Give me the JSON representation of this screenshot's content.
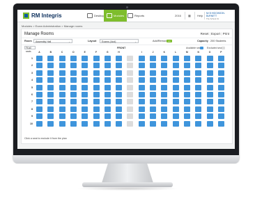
{
  "app": {
    "name": "RM Integris"
  },
  "nav": [
    {
      "label": "Desktop",
      "icon": "desktop-icon",
      "active": false
    },
    {
      "label": "Modules",
      "icon": "modules-icon",
      "active": true
    },
    {
      "label": "Reports",
      "icon": "reports-icon",
      "active": false
    }
  ],
  "top_right": {
    "item1": "2016",
    "help": "Help",
    "user": "Mr B HIGGINSON-BURNETT",
    "user_sub": "The School 01"
  },
  "breadcrumb": "Modules > Exam Administration > Manage rooms",
  "page": {
    "title": "Manage Rooms",
    "actions": [
      "Reset",
      "Export",
      "Print"
    ]
  },
  "filters": {
    "room_label": "Room",
    "room_value": "Assembly Hall",
    "layout_label": "Layout",
    "layout_value": "Exams (4col)",
    "add_label": "Add/Remove",
    "add_pill": "on",
    "capacity_label": "Capacity",
    "capacity_value": "200 Students"
  },
  "seating": {
    "zoom": "Fit all seats",
    "front_label": "FRONT",
    "legend_available": "Available seat",
    "legend_excluded": "Excluded seat",
    "columns": [
      "A",
      "B",
      "C",
      "D",
      "E",
      "F",
      "G",
      "H",
      "",
      "I",
      "J",
      "K",
      "L",
      "M",
      "N",
      "O",
      "P"
    ],
    "rows": [
      "1",
      "2",
      "3",
      "4",
      "5",
      "6",
      "7",
      "8",
      "9",
      "10"
    ]
  },
  "hint": "Click a seat to exclude it from the plan",
  "colors": {
    "seat": "#3f95dc",
    "excluded": "#dcdcdc",
    "accent": "#7ebd2c",
    "brand": "#0b2f5c"
  }
}
